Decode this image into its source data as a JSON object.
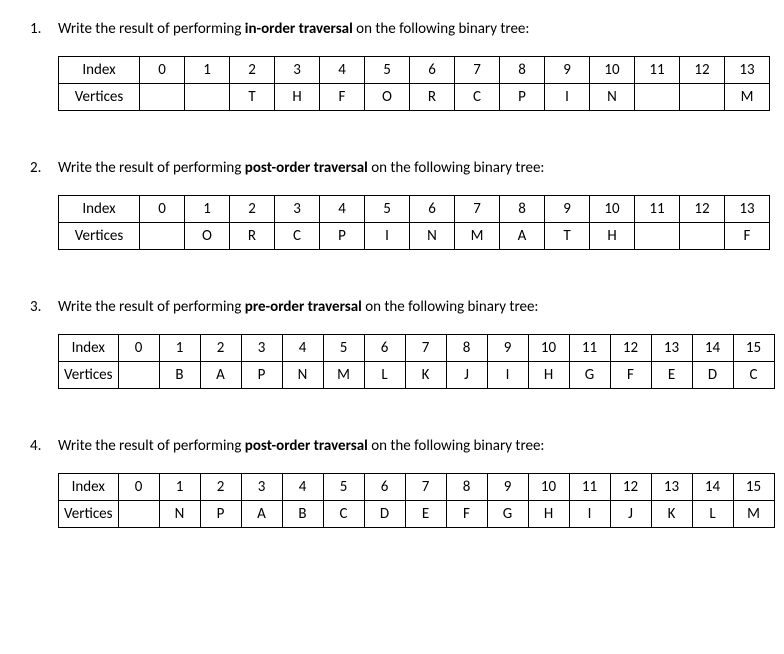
{
  "questions": [
    {
      "num": "1.",
      "pre": "Write the result of performing ",
      "bold": "in-order traversal",
      "post": " on the following binary tree:",
      "rowLabels": {
        "index": "Index",
        "vertices": "Vertices"
      },
      "index": [
        "0",
        "1",
        "2",
        "3",
        "4",
        "5",
        "6",
        "7",
        "8",
        "9",
        "10",
        "11",
        "12",
        "13"
      ],
      "vertices": [
        "",
        "",
        "T",
        "H",
        "F",
        "O",
        "R",
        "C",
        "P",
        "I",
        "N",
        "",
        "",
        "M"
      ]
    },
    {
      "num": "2.",
      "pre": "Write the result of performing ",
      "bold": "post-order traversal",
      "post": " on the following binary tree:",
      "rowLabels": {
        "index": "Index",
        "vertices": "Vertices"
      },
      "index": [
        "0",
        "1",
        "2",
        "3",
        "4",
        "5",
        "6",
        "7",
        "8",
        "9",
        "10",
        "11",
        "12",
        "13"
      ],
      "vertices": [
        "",
        "O",
        "R",
        "C",
        "P",
        "I",
        "N",
        "M",
        "A",
        "T",
        "H",
        "",
        "",
        "F"
      ]
    },
    {
      "num": "3.",
      "pre": "Write the result of performing ",
      "bold": "pre-order traversal",
      "post": " on the following binary tree:",
      "rowLabels": {
        "index": "Index",
        "vertices": "Vertices"
      },
      "index": [
        "0",
        "1",
        "2",
        "3",
        "4",
        "5",
        "6",
        "7",
        "8",
        "9",
        "10",
        "11",
        "12",
        "13",
        "14",
        "15"
      ],
      "vertices": [
        "",
        "B",
        "A",
        "P",
        "N",
        "M",
        "L",
        "K",
        "J",
        "I",
        "H",
        "G",
        "F",
        "E",
        "D",
        "C"
      ]
    },
    {
      "num": "4.",
      "pre": "Write the result of performing ",
      "bold": "post-order traversal",
      "post": " on the following binary tree:",
      "rowLabels": {
        "index": "Index",
        "vertices": "Vertices"
      },
      "index": [
        "0",
        "1",
        "2",
        "3",
        "4",
        "5",
        "6",
        "7",
        "8",
        "9",
        "10",
        "11",
        "12",
        "13",
        "14",
        "15"
      ],
      "vertices": [
        "",
        "N",
        "P",
        "A",
        "B",
        "C",
        "D",
        "E",
        "F",
        "G",
        "H",
        "I",
        "J",
        "K",
        "L",
        "M"
      ]
    }
  ]
}
